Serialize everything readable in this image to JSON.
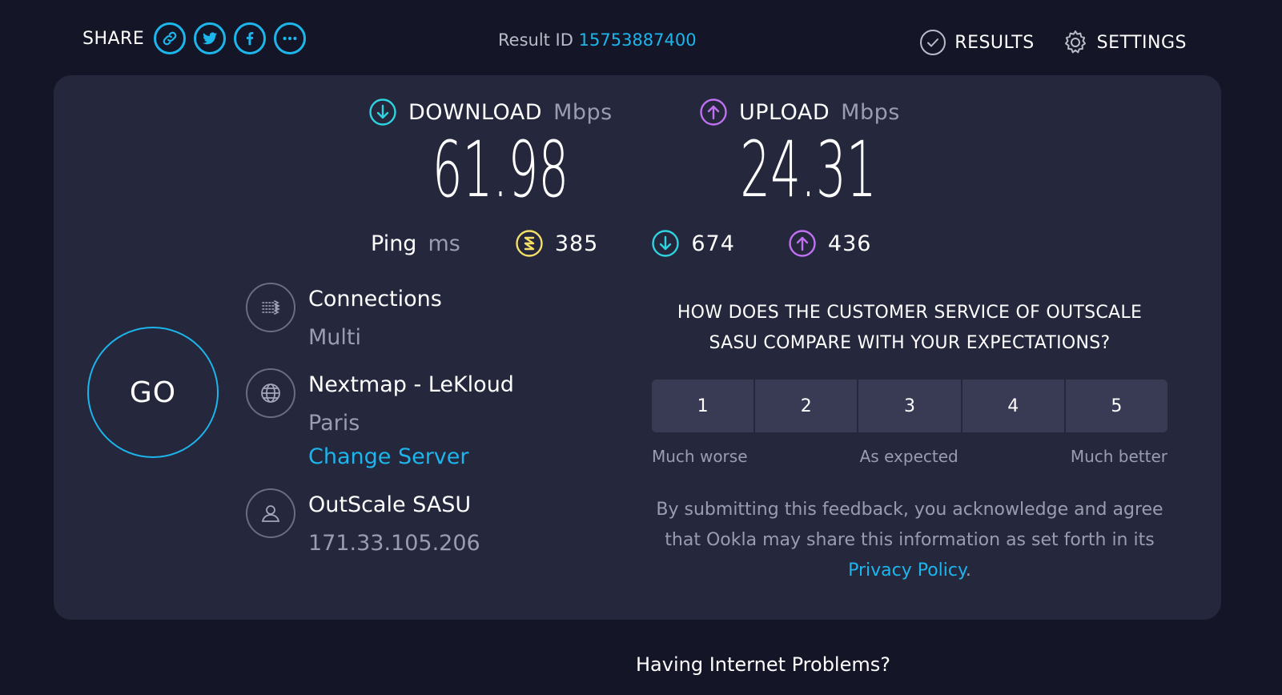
{
  "header": {
    "share_label": "SHARE",
    "share_buttons": [
      {
        "name": "link-icon"
      },
      {
        "name": "twitter-icon"
      },
      {
        "name": "facebook-icon"
      },
      {
        "name": "more-icon"
      }
    ],
    "result_id_label": "Result ID",
    "result_id": "15753887400",
    "nav": {
      "results_label": "RESULTS",
      "results_icon": "check-circle-icon",
      "settings_label": "SETTINGS",
      "settings_icon": "gear-icon"
    }
  },
  "speeds": {
    "download": {
      "label": "DOWNLOAD",
      "unit": "Mbps",
      "value": "61.98",
      "icon": "download-arrow-icon",
      "color": "#2fd3e0"
    },
    "upload": {
      "label": "UPLOAD",
      "unit": "Mbps",
      "value": "24.31",
      "icon": "upload-arrow-icon",
      "color": "#bf71f2"
    }
  },
  "ping": {
    "label": "Ping",
    "unit": "ms",
    "idle": {
      "value": "385",
      "icon": "idle-ping-icon",
      "color": "#f4e068"
    },
    "download": {
      "value": "674",
      "icon": "download-ping-icon",
      "color": "#2fd3e0"
    },
    "upload": {
      "value": "436",
      "icon": "upload-ping-icon",
      "color": "#bf71f2"
    }
  },
  "go_label": "GO",
  "connections": {
    "title": "Connections",
    "value": "Multi",
    "icon": "connections-icon"
  },
  "server": {
    "title": "Nextmap - LeKloud",
    "location": "Paris",
    "change_label": "Change Server",
    "icon": "globe-icon"
  },
  "provider": {
    "title": "OutScale SASU",
    "ip": "171.33.105.206",
    "icon": "user-icon"
  },
  "survey": {
    "question": "HOW DOES THE CUSTOMER SERVICE OF OUTSCALE SASU COMPARE WITH YOUR EXPECTATIONS?",
    "ratings": [
      "1",
      "2",
      "3",
      "4",
      "5"
    ],
    "scale_low": "Much worse",
    "scale_mid": "As expected",
    "scale_high": "Much better",
    "disclaimer": "By submitting this feedback, you acknowledge and agree that Ookla may share this information as set forth in its",
    "privacy_link": "Privacy Policy",
    "period": "."
  },
  "footer": {
    "question": "Having Internet Problems?"
  },
  "colors": {
    "accent": "#1cb5ec",
    "background": "#141526",
    "card": "#25273c",
    "button": "#393b54"
  }
}
